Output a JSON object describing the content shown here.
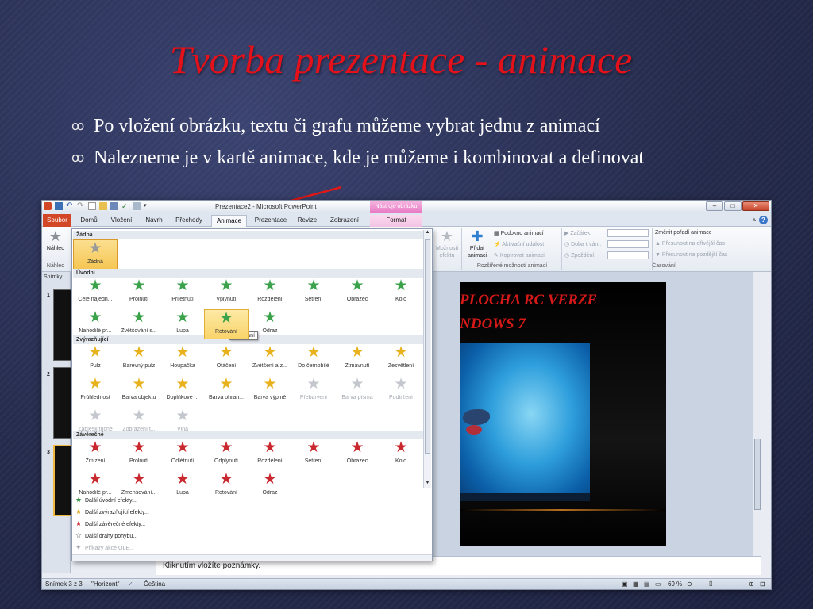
{
  "slide": {
    "title": "Tvorba prezentace - animace",
    "bullet_glyph": "ꝏ",
    "bullets": [
      "Po vložení obrázku, textu či grafu můžeme vybrat jednu z animací",
      "Nalezneme je v kartě animace, kde je můžeme i kombinovat a definovat"
    ]
  },
  "window": {
    "title": "Prezentace2 - Microsoft PowerPoint",
    "context_tools": "Nástroje obrázku",
    "buttons": {
      "minimize": "–",
      "maximize": "□",
      "close": "✕"
    }
  },
  "tabs": [
    {
      "label": "Soubor"
    },
    {
      "label": "Domů"
    },
    {
      "label": "Vložení"
    },
    {
      "label": "Návrh"
    },
    {
      "label": "Přechody"
    },
    {
      "label": "Animace"
    },
    {
      "label": "Prezentace"
    },
    {
      "label": "Revize"
    },
    {
      "label": "Zobrazení"
    },
    {
      "label": "Formát"
    }
  ],
  "ribbon": {
    "preview": {
      "label": "Náhled",
      "group": "Náhled"
    },
    "effect_options": "Možnosti efektu",
    "add_animation": "Přidat animaci",
    "animation_pane": "Podokno animací",
    "trigger": "Aktivační událost",
    "painter": "Kopírovat animaci",
    "advanced_group": "Rozšířené možnosti animací",
    "start": "Začátek:",
    "duration": "Doba trvání:",
    "delay": "Zpoždění:",
    "reorder": "Změnit pořadí animace",
    "move_earlier": "Přesunout na dřívější čas",
    "move_later": "Přesunout na pozdější čas",
    "timing_group": "Časování"
  },
  "thumbnails": {
    "header": "Snímky",
    "numbers": [
      "1",
      "2",
      "3"
    ]
  },
  "gallery": {
    "none_section": "Žádná",
    "none_item": "Žádná",
    "entrance_section": "Úvodní",
    "entrance": [
      "Celé najedn...",
      "Prolnutí",
      "Přilétnutí",
      "Vplynutí",
      "Rozdělení",
      "Setření",
      "Obrazec",
      "Kolo",
      "Nahodilé pr...",
      "Zvětšování s...",
      "Lupa",
      "Rotování",
      "Odraz"
    ],
    "emphasis_section": "Zvýrazňující",
    "emphasis": [
      "Pulz",
      "Barevný pulz",
      "Houpačka",
      "Otáčení",
      "Zvětšení a z...",
      "Do černobílé",
      "Ztmavnutí",
      "Zesvětlení",
      "Průhlednost",
      "Barva objektu",
      "Doplňkové ...",
      "Barva ohran...",
      "Barva výplně",
      "Přebarvení",
      "Barva písma",
      "Podtržení",
      "Záblesk tučně",
      "Zobrazení t...",
      "Vlna"
    ],
    "exit_section": "Závěrečné",
    "exit": [
      "Zmizení",
      "Prolnutí",
      "Odlétnutí",
      "Odplynutí",
      "Rozdělení",
      "Setření",
      "Obrazec",
      "Kolo",
      "Nahodilé pr...",
      "Zmenšování...",
      "Lupa",
      "Rotování",
      "Odraz"
    ],
    "tooltip": "Rotování",
    "more": [
      "Další úvodní efekty...",
      "Další zvýrazňující efekty...",
      "Další závěrečné efekty...",
      "Další dráhy pohybu...",
      "Příkazy akce OLE..."
    ]
  },
  "content_slide": {
    "line1": "PLOCHA RC VERZE",
    "line2": "NDOWS 7"
  },
  "notes_placeholder": "Kliknutím vložíte poznámky.",
  "statusbar": {
    "slide": "Snímek 3 z 3",
    "theme": "\"Horizont\"",
    "language": "Čeština",
    "zoom": "69 %"
  },
  "colors": {
    "title_red": "#e4101a",
    "file_tab": "#d24726",
    "context_pink": "#e777c3",
    "entrance_green": "#3aa24a",
    "emphasis_gold": "#e8b21f",
    "exit_red": "#c8282e"
  }
}
